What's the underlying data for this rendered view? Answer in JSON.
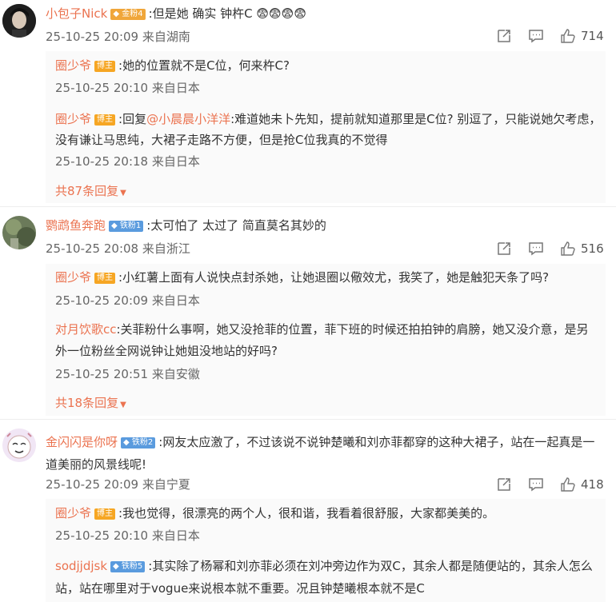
{
  "comments": [
    {
      "user": "小包子Nick",
      "badge": "金粉4",
      "text": ":但是她 确实 钟杵C 😨😨😨😨",
      "meta": "25-10-25 20:09 来自湖南",
      "likes": "714",
      "replies": [
        {
          "user": "圈少爷",
          "badge": "博主",
          "text": ":她的位置就不是C位，何来杵C?",
          "meta": "25-10-25 20:10 来自日本"
        },
        {
          "user": "圈少爷",
          "badge": "博主",
          "text_prefix": ":回复",
          "mention": "@小晨晨小洋洋",
          "text": ":难道她未卜先知，提前就知道那里是C位? 别逗了，只能说她欠考虑，没有谦让马思纯，大裙子走路不方便，但是抢C位我真的不觉得",
          "meta": "25-10-25 20:18 来自日本"
        }
      ],
      "more": "共87条回复"
    },
    {
      "user": "鹦鹉鱼奔跑",
      "badge": "铁粉1",
      "text": ":太可怕了 太过了 简直莫名其妙的",
      "meta": "25-10-25 20:08 来自浙江",
      "likes": "516",
      "replies": [
        {
          "user": "圈少爷",
          "badge": "博主",
          "text": ":小红薯上面有人说快点封杀她，让她退圈以儆效尤，我笑了，她是触犯天条了吗?",
          "meta": "25-10-25 20:09 来自日本"
        },
        {
          "user": "对月饮歌cc",
          "text": ":关菲粉什么事啊，她又没抢菲的位置，菲下班的时候还拍拍钟的肩膀，她又没介意，是另外一位粉丝全网说钟让她姐没地站的好吗?",
          "meta": "25-10-25 20:51 来自安徽"
        }
      ],
      "more": "共18条回复"
    },
    {
      "user": "金闪闪是你呀",
      "badge": "铁粉2",
      "text": ":网友太应激了，不过该说不说钟楚曦和刘亦菲都穿的这种大裙子，站在一起真是一道美丽的风景线呢!",
      "meta": "25-10-25 20:09 来自宁夏",
      "likes": "418",
      "replies": [
        {
          "user": "圈少爷",
          "badge": "博主",
          "text": ":我也觉得，很漂亮的两个人，很和谐，我看着很舒服，大家都美美的。",
          "meta": "25-10-25 20:10 来自日本"
        },
        {
          "user": "sodjjdjsk",
          "badge": "铁粉5",
          "text": ":其实除了杨幂和刘亦菲必须在刘冲旁边作为双C，其余人都是随便站的，其余人怎么站，站在哪里对于vogue来说根本就不重要。况且钟楚曦根本就不是C"
        }
      ]
    }
  ],
  "colors": {
    "accent": "#eb7350",
    "text": "#333333",
    "meta": "#666666"
  },
  "icons": [
    "share-icon",
    "comment-icon",
    "like-icon",
    "caret-down-icon"
  ]
}
